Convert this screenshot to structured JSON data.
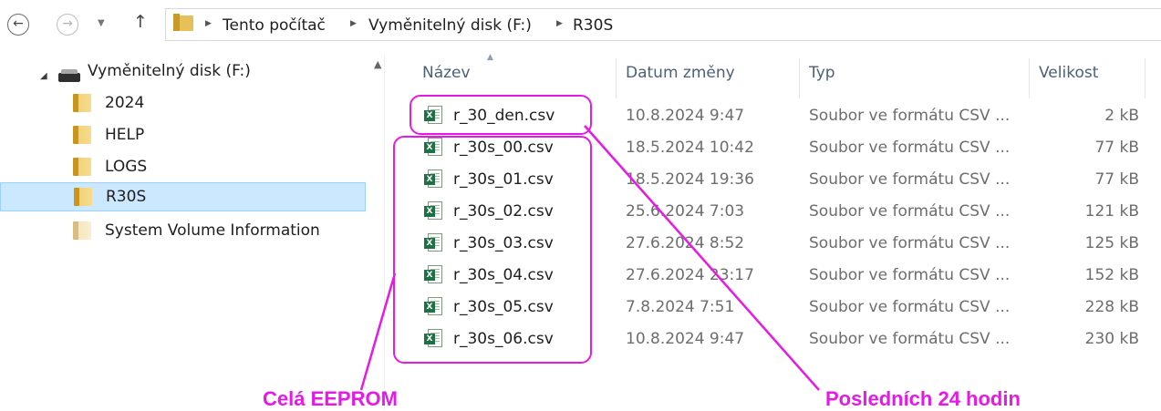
{
  "address_bar": {
    "back_icon": "back-arrow-icon",
    "forward_icon": "forward-arrow-icon",
    "up_icon": "up-arrow-icon",
    "crumbs": [
      "Tento počítač",
      "Vyměnitelný disk (F:)",
      "R30S"
    ]
  },
  "nav": {
    "drive": "Vyměnitelný disk (F:)",
    "folders": [
      "2024",
      "HELP",
      "LOGS",
      "R30S",
      "System Volume Information"
    ],
    "selected": "R30S"
  },
  "columns": {
    "name": "Název",
    "date": "Datum změny",
    "type": "Typ",
    "size": "Velikost"
  },
  "files": [
    {
      "name": "r_30_den.csv",
      "date": "10.8.2024 9:47",
      "type": "Soubor ve formátu CSV ...",
      "size": "2 kB"
    },
    {
      "name": "r_30s_00.csv",
      "date": "18.5.2024 10:42",
      "type": "Soubor ve formátu CSV ...",
      "size": "77 kB"
    },
    {
      "name": "r_30s_01.csv",
      "date": "18.5.2024 19:36",
      "type": "Soubor ve formátu CSV ...",
      "size": "77 kB"
    },
    {
      "name": "r_30s_02.csv",
      "date": "25.6.2024 7:03",
      "type": "Soubor ve formátu CSV ...",
      "size": "121 kB"
    },
    {
      "name": "r_30s_03.csv",
      "date": "27.6.2024 8:52",
      "type": "Soubor ve formátu CSV ...",
      "size": "125 kB"
    },
    {
      "name": "r_30s_04.csv",
      "date": "27.6.2024 23:17",
      "type": "Soubor ve formátu CSV ...",
      "size": "152 kB"
    },
    {
      "name": "r_30s_05.csv",
      "date": "7.8.2024 7:51",
      "type": "Soubor ve formátu CSV ...",
      "size": "228 kB"
    },
    {
      "name": "r_30s_06.csv",
      "date": "10.8.2024 9:47",
      "type": "Soubor ve formátu CSV ...",
      "size": "230 kB"
    }
  ],
  "annotations": {
    "left_label": "Celá EEPROM",
    "right_label": "Posledních 24 hodin",
    "color": "#e619e6"
  }
}
